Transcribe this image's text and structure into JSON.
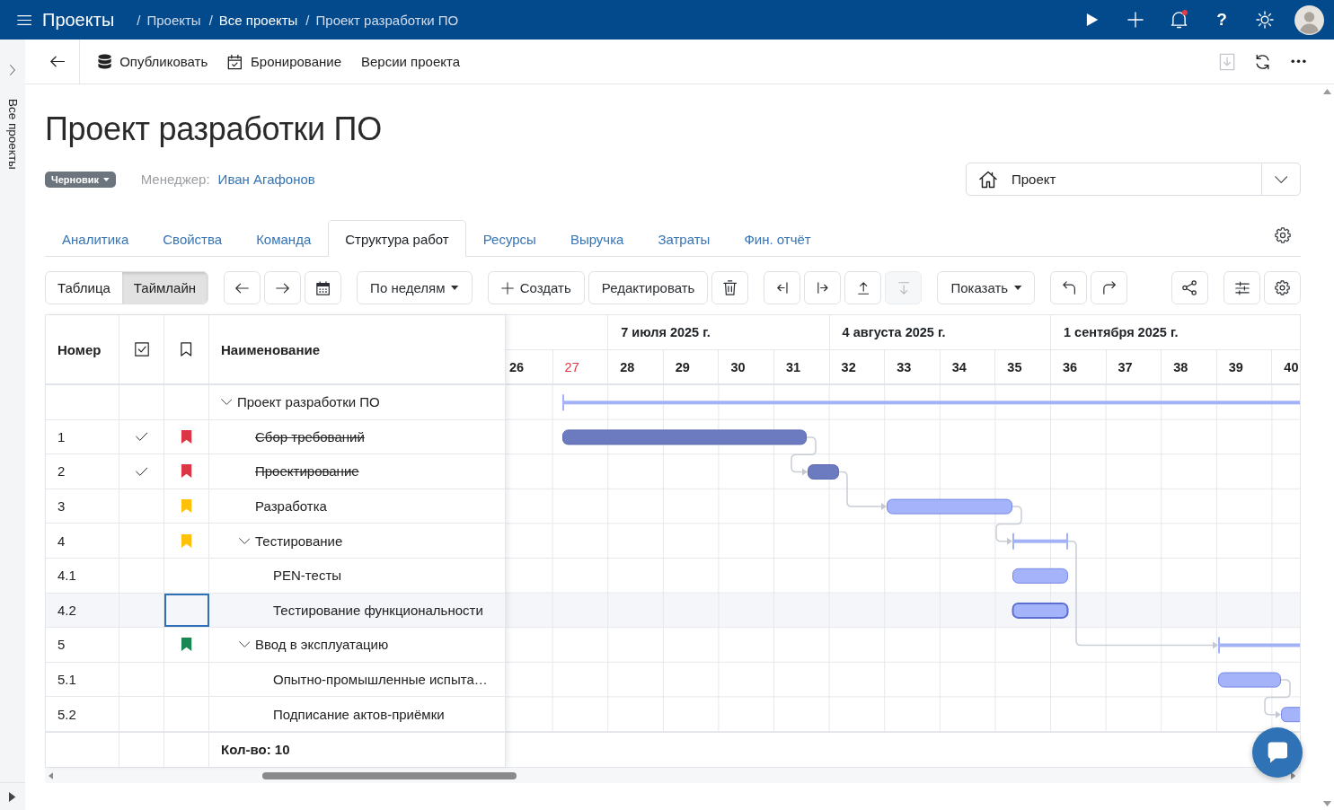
{
  "topbar": {
    "app_title": "Проекты",
    "breadcrumbs": [
      {
        "separator": "/",
        "label": "Проекты",
        "highlighted": false
      },
      {
        "separator": "/",
        "label": "Все проекты",
        "highlighted": true
      },
      {
        "separator": "/",
        "label": "Проект разработки ПО",
        "highlighted": false
      }
    ],
    "actions": [
      {
        "kind": "run"
      },
      {
        "kind": "add"
      },
      {
        "kind": "notifications"
      },
      {
        "kind": "help",
        "label": "?"
      },
      {
        "kind": "theme"
      }
    ],
    "unread": true
  },
  "sidebar": {
    "label": "Все проекты"
  },
  "actionbar": {
    "items": [
      {
        "kind": "publish",
        "label": "Опубликовать"
      },
      {
        "kind": "booking",
        "label": "Бронирование"
      },
      {
        "kind": "versions",
        "label": "Версии проекта"
      }
    ],
    "tools": [
      {
        "kind": "save",
        "disabled": true
      },
      {
        "kind": "refresh",
        "disabled": false
      },
      {
        "kind": "more",
        "disabled": false
      }
    ]
  },
  "project": {
    "title": "Проект разработки ПО",
    "status": "Черновик",
    "manager_label": "Менеджер:",
    "manager": "Иван Агафонов",
    "selector": "Проект"
  },
  "tabs": [
    {
      "label": "Аналитика",
      "selected": false
    },
    {
      "label": "Свойства",
      "selected": false
    },
    {
      "label": "Команда",
      "selected": false
    },
    {
      "label": "Структура работ",
      "selected": true
    },
    {
      "label": "Ресурсы",
      "selected": false
    },
    {
      "label": "Выручка",
      "selected": false
    },
    {
      "label": "Затраты",
      "selected": false
    },
    {
      "label": "Фин. отчёт",
      "selected": false
    }
  ],
  "view_switch": [
    {
      "label": "Таблица",
      "selected": false
    },
    {
      "label": "Таймлайн",
      "selected": true
    }
  ],
  "tool_groups": [
    [
      {
        "kind": "prev",
        "disabled": false
      },
      {
        "kind": "next",
        "disabled": false
      },
      {
        "kind": "calendar",
        "disabled": false
      }
    ],
    [
      {
        "kind": "period",
        "label": "По неделям",
        "disabled": false
      }
    ],
    [
      {
        "kind": "create",
        "label": "Создать",
        "disabled": false
      },
      {
        "kind": "edit",
        "label": "Редактировать",
        "disabled": false
      },
      {
        "kind": "delete",
        "disabled": false
      }
    ],
    [
      {
        "kind": "outdent",
        "disabled": false
      },
      {
        "kind": "indent",
        "disabled": false
      },
      {
        "kind": "move_up",
        "disabled": false
      },
      {
        "kind": "move_down",
        "disabled": true
      }
    ],
    [
      {
        "kind": "show",
        "label": "Показать",
        "disabled": false
      }
    ],
    [
      {
        "kind": "undo",
        "disabled": false
      },
      {
        "kind": "redo",
        "disabled": false
      }
    ],
    [
      {
        "kind": "share",
        "disabled": false
      }
    ],
    [
      {
        "kind": "columns",
        "disabled": false
      },
      {
        "kind": "settings",
        "disabled": false
      }
    ]
  ],
  "table": {
    "columns": [
      {
        "kind": "number",
        "label": "Номер"
      },
      {
        "kind": "done"
      },
      {
        "kind": "flag"
      },
      {
        "kind": "name",
        "label": "Наименование"
      }
    ],
    "rows": [
      {
        "name": "Проект разработки ПО",
        "done": false,
        "selected": false,
        "expanded": true,
        "children": [
          {
            "number": "1",
            "name": "Сбор требований",
            "done": true,
            "color": "#dc3545",
            "selected": false
          },
          {
            "number": "2",
            "name": "Проектирование",
            "done": true,
            "color": "#dc3545",
            "selected": false
          },
          {
            "number": "3",
            "name": "Разработка",
            "done": false,
            "color": "#ffc107",
            "selected": false
          },
          {
            "number": "4",
            "name": "Тестирование",
            "done": false,
            "color": "#ffc107",
            "selected": false,
            "expanded": true,
            "children": [
              {
                "number": "4.1",
                "name": "PEN-тесты",
                "done": false,
                "selected": false
              },
              {
                "number": "4.2",
                "name": "Тестирование функциональности",
                "done": false,
                "selected": true
              }
            ]
          },
          {
            "number": "5",
            "name": "Ввод в эксплуатацию",
            "done": false,
            "color": "#198754",
            "selected": false,
            "expanded": true,
            "children": [
              {
                "number": "5.1",
                "name": "Опытно-промышленные испыта…",
                "done": false,
                "selected": false
              },
              {
                "number": "5.2",
                "name": "Подписание актов-приёмки",
                "done": false,
                "selected": false
              }
            ]
          }
        ]
      }
    ],
    "footer": "Кол-во: 10"
  },
  "timeline": {
    "weeks": [
      {
        "label": "26",
        "current": false
      },
      {
        "label": "27",
        "current": true
      },
      {
        "label": "28",
        "current": false,
        "month": "7 июля 2025 г."
      },
      {
        "label": "29",
        "current": false
      },
      {
        "label": "30",
        "current": false
      },
      {
        "label": "31",
        "current": false
      },
      {
        "label": "32",
        "current": false,
        "month": "4 августа 2025 г."
      },
      {
        "label": "33",
        "current": false
      },
      {
        "label": "34",
        "current": false
      },
      {
        "label": "35",
        "current": false
      },
      {
        "label": "36",
        "current": false,
        "month": "1 сентября 2025 г."
      },
      {
        "label": "37",
        "current": false
      },
      {
        "label": "38",
        "current": false
      },
      {
        "label": "39",
        "current": false
      },
      {
        "label": "40",
        "current": false
      }
    ]
  }
}
